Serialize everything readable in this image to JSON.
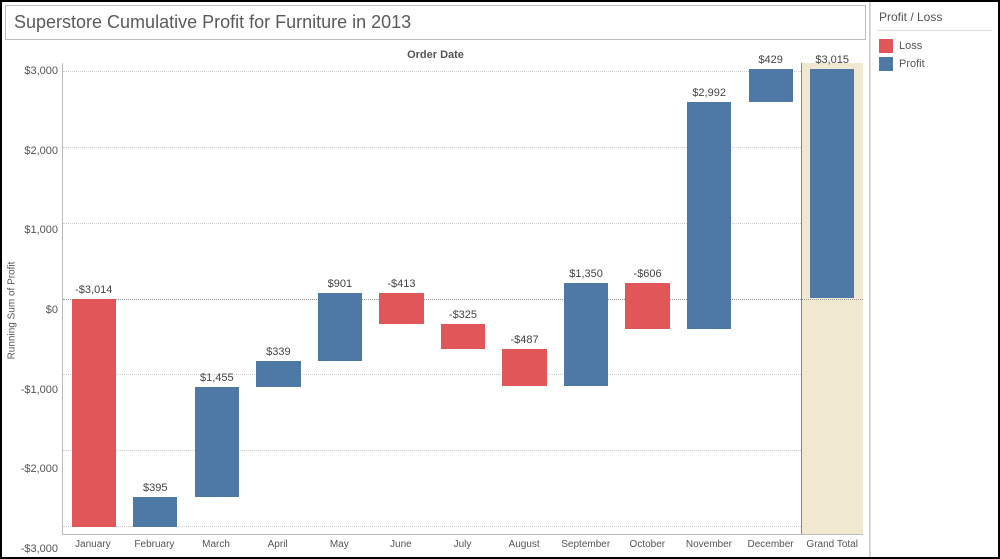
{
  "title": "Superstore Cumulative Profit for Furniture in 2013",
  "axis_top": "Order Date",
  "yaxis_label": "Running Sum of Profit",
  "yticks": [
    "-$3,000",
    "-$2,000",
    "-$1,000",
    "$0",
    "$1,000",
    "$2,000",
    "$3,000"
  ],
  "legend": {
    "title": "Profit / Loss",
    "items": [
      {
        "label": "Loss",
        "color": "#e15759"
      },
      {
        "label": "Profit",
        "color": "#4e79a7"
      }
    ]
  },
  "chart_data": {
    "type": "bar",
    "subtype": "waterfall",
    "title": "Superstore Cumulative Profit for Furniture in 2013",
    "xlabel": "Order Date",
    "ylabel": "Running Sum of Profit",
    "ylim": [
      -3100,
      3100
    ],
    "categories": [
      "January",
      "February",
      "March",
      "April",
      "May",
      "June",
      "July",
      "August",
      "September",
      "October",
      "November",
      "December",
      "Grand Total"
    ],
    "series": [
      {
        "name": "delta",
        "values": [
          -3014,
          395,
          1455,
          339,
          901,
          -413,
          -325,
          -487,
          1350,
          -606,
          2992,
          429,
          3015
        ],
        "labels": [
          "-$3,014",
          "$395",
          "$1,455",
          "$339",
          "$901",
          "-$413",
          "-$325",
          "-$487",
          "$1,350",
          "-$606",
          "$2,992",
          "$429",
          "$3,015"
        ],
        "class": [
          "loss",
          "profit",
          "profit",
          "profit",
          "profit",
          "loss",
          "loss",
          "loss",
          "profit",
          "loss",
          "profit",
          "profit",
          "profit"
        ],
        "is_total": [
          false,
          false,
          false,
          false,
          false,
          false,
          false,
          false,
          false,
          false,
          false,
          false,
          true
        ]
      }
    ],
    "legend": {
      "Loss": "#e15759",
      "Profit": "#4e79a7"
    }
  }
}
